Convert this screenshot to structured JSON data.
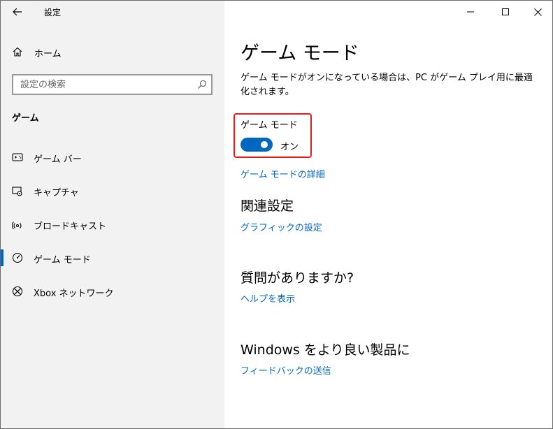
{
  "window": {
    "title": "設定",
    "controls": {
      "minimize_icon": "minimize-icon",
      "maximize_icon": "maximize-icon",
      "close_icon": "close-icon"
    }
  },
  "sidebar": {
    "home_label": "ホーム",
    "search": {
      "placeholder": "設定の検索",
      "value": ""
    },
    "section_title": "ゲーム",
    "items": [
      {
        "label": "ゲーム バー",
        "icon": "game-bar-icon"
      },
      {
        "label": "キャプチャ",
        "icon": "capture-icon"
      },
      {
        "label": "ブロードキャスト",
        "icon": "broadcast-icon"
      },
      {
        "label": "ゲーム モード",
        "icon": "game-mode-icon",
        "active": true
      },
      {
        "label": "Xbox ネットワーク",
        "icon": "xbox-icon"
      }
    ]
  },
  "main": {
    "title": "ゲーム モード",
    "description": "ゲーム モードがオンになっている場合は、PC がゲーム プレイ用に最適化されます。",
    "setting_label": "ゲーム モード",
    "toggle_state": "オン",
    "details_link": "ゲーム モードの詳細",
    "related_heading": "関連設定",
    "graphics_link": "グラフィックの設定",
    "question_heading": "質問がありますか?",
    "help_link": "ヘルプを表示",
    "improve_heading": "Windows をより良い製品に",
    "feedback_link": "フィードバックの送信"
  },
  "colors": {
    "accent": "#0067c0",
    "highlight": "#e81b1b",
    "sidebar_bg": "#f2f2f2"
  }
}
